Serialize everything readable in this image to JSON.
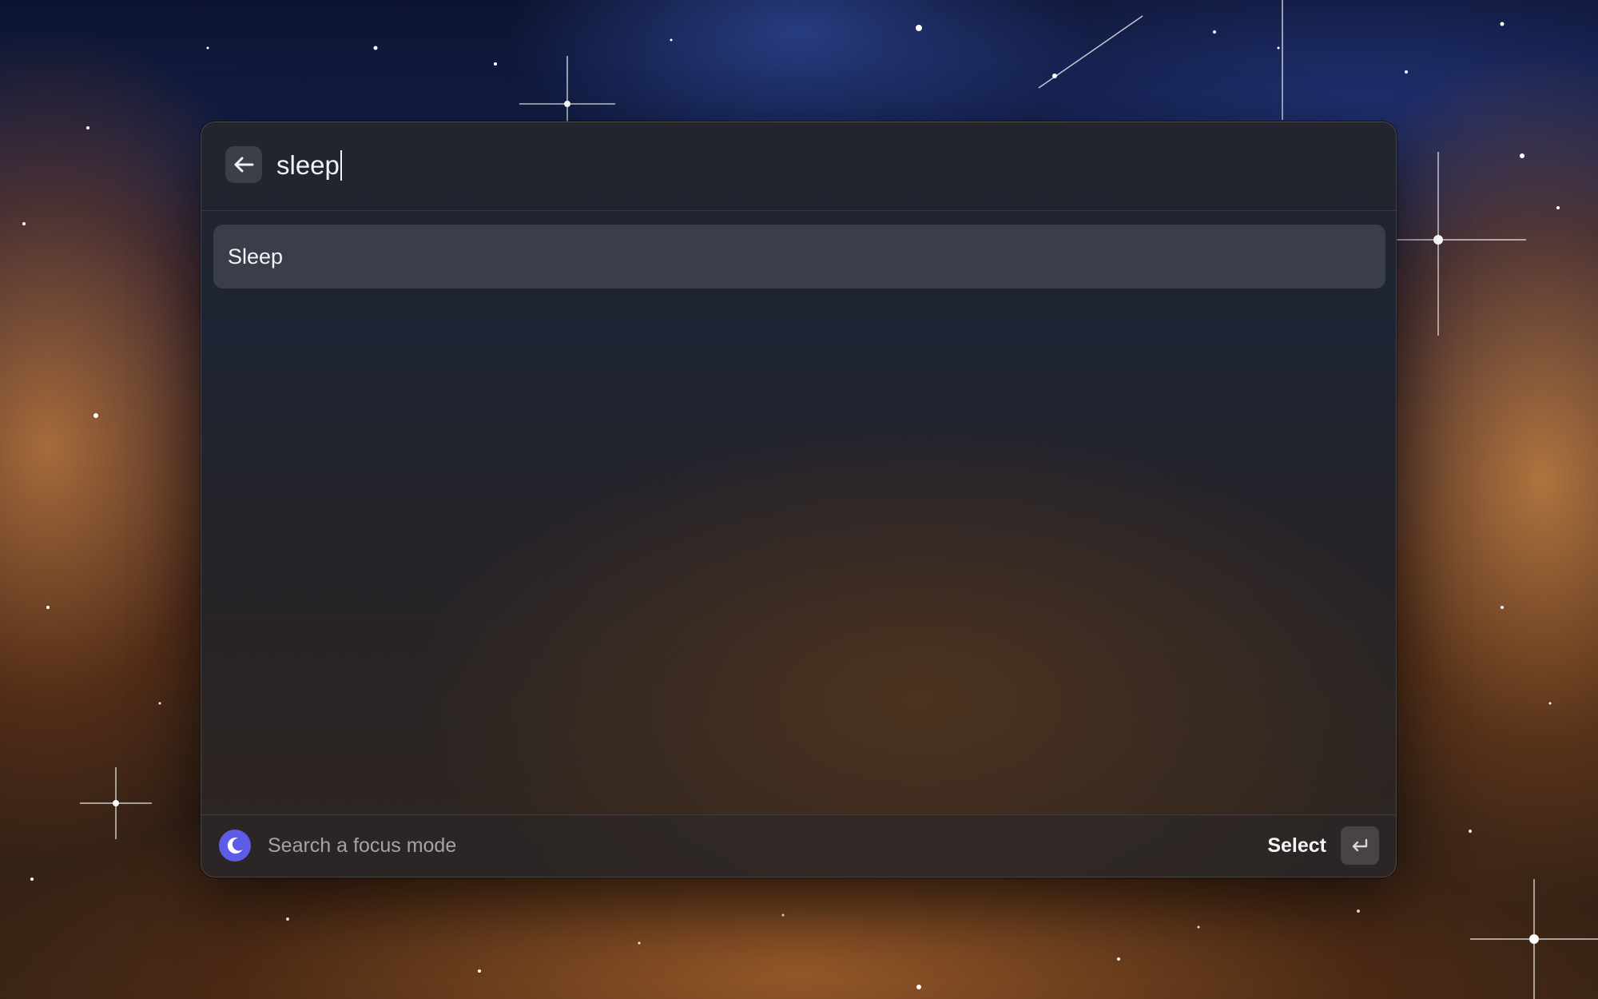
{
  "search": {
    "value": "sleep",
    "back_icon": "arrow-left-icon"
  },
  "results": [
    {
      "label": "Sleep",
      "selected": true
    }
  ],
  "footer": {
    "icon": "moon-icon",
    "icon_color": "#5e5ce6",
    "hint": "Search a focus mode",
    "action_label": "Select",
    "action_key_icon": "return-key-icon"
  }
}
